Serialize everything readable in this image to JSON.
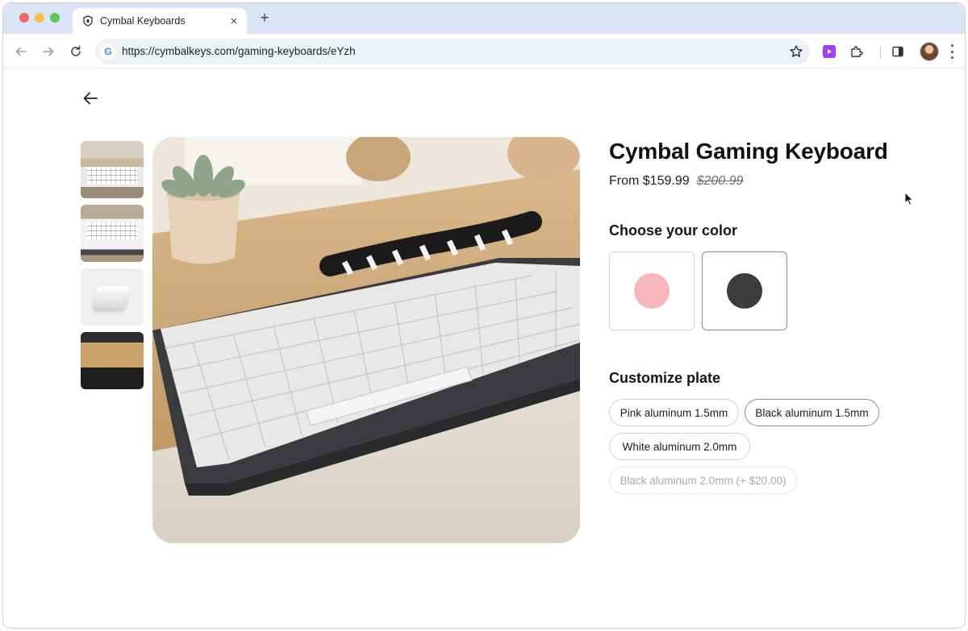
{
  "browser": {
    "tab_title": "Cymbal Keyboards",
    "tab_close_glyph": "×",
    "new_tab_glyph": "+",
    "url": "https://cymbalkeys.com/gaming-keyboards/eYzh",
    "google_glyph": "G",
    "icons": [
      "back-icon",
      "forward-icon",
      "reload-icon",
      "star-icon",
      "extension-play-icon",
      "puzzle-icon",
      "sidebar-icon",
      "avatar",
      "menu-icon"
    ]
  },
  "product": {
    "title": "Cymbal Gaming Keyboard",
    "price": "From $159.99",
    "original_price": "$200.99"
  },
  "color_section": {
    "title": "Choose your color",
    "options": [
      {
        "color": "#f7b7bd",
        "selected": false
      },
      {
        "color": "#3a3b3d",
        "selected": true
      }
    ]
  },
  "plate_section": {
    "title": "Customize plate",
    "options": [
      {
        "label": "Pink aluminum 1.5mm",
        "selected": false,
        "disabled": false
      },
      {
        "label": "Black aluminum 1.5mm",
        "selected": true,
        "disabled": false
      },
      {
        "label": "White aluminum 2.0mm",
        "selected": false,
        "disabled": false
      },
      {
        "label": "Black aluminum 2.0mm (+ $20.00)",
        "selected": false,
        "disabled": true
      }
    ]
  },
  "gallery": {
    "thumbnail_count": 4
  }
}
